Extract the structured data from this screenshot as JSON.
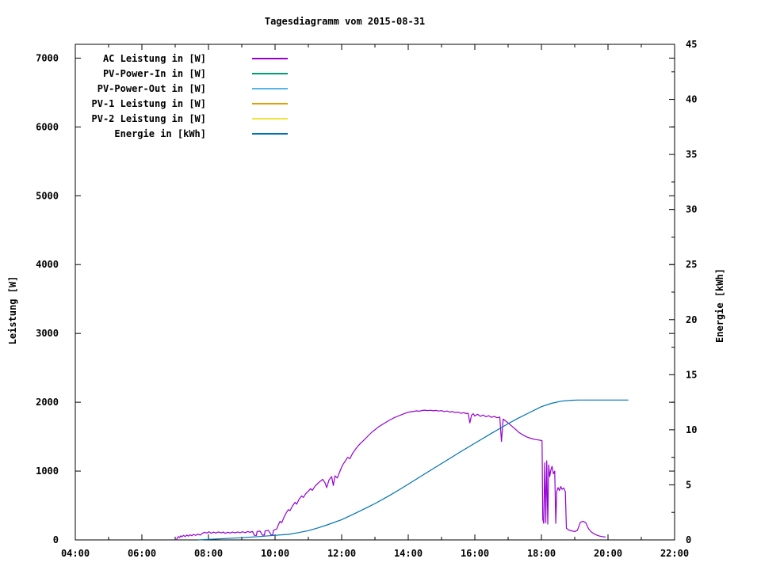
{
  "chart_data": {
    "type": "line",
    "title": "Tagesdiagramm vom 2015-08-31",
    "xlabel": "",
    "ylabel": "Leistung [W]",
    "y2label": "Energie [kWh]",
    "grid": false,
    "legend_position": "top-left-inside",
    "xlim_hours": [
      4,
      22
    ],
    "ylim": [
      0,
      7200
    ],
    "y2lim": [
      0,
      45
    ],
    "x_ticks": [
      {
        "hour": 4,
        "label": "04:00"
      },
      {
        "hour": 6,
        "label": "06:00"
      },
      {
        "hour": 8,
        "label": "08:00"
      },
      {
        "hour": 10,
        "label": "10:00"
      },
      {
        "hour": 12,
        "label": "12:00"
      },
      {
        "hour": 14,
        "label": "14:00"
      },
      {
        "hour": 16,
        "label": "16:00"
      },
      {
        "hour": 18,
        "label": "18:00"
      },
      {
        "hour": 20,
        "label": "20:00"
      },
      {
        "hour": 22,
        "label": "22:00"
      }
    ],
    "x_minor_hours": [
      5,
      7,
      9,
      11,
      13,
      15,
      17,
      19,
      21
    ],
    "y_ticks": [
      {
        "value": 0,
        "label": "0"
      },
      {
        "value": 1000,
        "label": "1000"
      },
      {
        "value": 2000,
        "label": "2000"
      },
      {
        "value": 3000,
        "label": "3000"
      },
      {
        "value": 4000,
        "label": "4000"
      },
      {
        "value": 5000,
        "label": "5000"
      },
      {
        "value": 6000,
        "label": "6000"
      },
      {
        "value": 7000,
        "label": "7000"
      }
    ],
    "y2_ticks": [
      {
        "value": 0,
        "label": "0"
      },
      {
        "value": 5,
        "label": "5"
      },
      {
        "value": 10,
        "label": "10"
      },
      {
        "value": 15,
        "label": "15"
      },
      {
        "value": 20,
        "label": "20"
      },
      {
        "value": 25,
        "label": "25"
      },
      {
        "value": 30,
        "label": "30"
      },
      {
        "value": 35,
        "label": "35"
      },
      {
        "value": 40,
        "label": "40"
      },
      {
        "value": 45,
        "label": "45"
      }
    ],
    "y2_minor": [
      2.5,
      7.5,
      12.5,
      17.5,
      22.5,
      27.5,
      32.5,
      37.5,
      42.5
    ],
    "colors": {
      "axis": "#000000",
      "background": "#ffffff",
      "ac": "#9400d3",
      "pv_power_in": "#009e73",
      "pv_power_out": "#56b4e9",
      "pv1": "#e69f00",
      "pv2": "#f0e442",
      "energie": "#0072b2"
    },
    "legend": [
      {
        "label": "AC Leistung in [W]",
        "color": "#9400d3"
      },
      {
        "label": "PV-Power-In in [W]",
        "color": "#009e73"
      },
      {
        "label": "PV-Power-Out in [W]",
        "color": "#56b4e9"
      },
      {
        "label": "PV-1 Leistung in [W]",
        "color": "#e69f00"
      },
      {
        "label": "PV-2 Leistung in [W]",
        "color": "#f0e442"
      },
      {
        "label": "Energie in [kWh]",
        "color": "#0072b2"
      }
    ],
    "series": [
      {
        "name": "AC Leistung in [W]",
        "color": "#9400d3",
        "axis": "left",
        "points": [
          [
            7.03,
            0
          ],
          [
            7.07,
            30
          ],
          [
            7.1,
            50
          ],
          [
            7.13,
            35
          ],
          [
            7.17,
            60
          ],
          [
            7.2,
            45
          ],
          [
            7.25,
            65
          ],
          [
            7.3,
            50
          ],
          [
            7.35,
            70
          ],
          [
            7.4,
            55
          ],
          [
            7.45,
            75
          ],
          [
            7.5,
            60
          ],
          [
            7.55,
            80
          ],
          [
            7.62,
            65
          ],
          [
            7.68,
            85
          ],
          [
            7.75,
            70
          ],
          [
            7.82,
            95
          ],
          [
            7.88,
            112
          ],
          [
            7.95,
            100
          ],
          [
            8.02,
            118
          ],
          [
            8.08,
            96
          ],
          [
            8.15,
            114
          ],
          [
            8.22,
            100
          ],
          [
            8.3,
            116
          ],
          [
            8.38,
            102
          ],
          [
            8.45,
            114
          ],
          [
            8.5,
            96
          ],
          [
            8.58,
            112
          ],
          [
            8.65,
            100
          ],
          [
            8.72,
            114
          ],
          [
            8.8,
            102
          ],
          [
            8.88,
            116
          ],
          [
            8.95,
            104
          ],
          [
            9.02,
            118
          ],
          [
            9.1,
            106
          ],
          [
            9.18,
            122
          ],
          [
            9.25,
            110
          ],
          [
            9.32,
            124
          ],
          [
            9.38,
            66
          ],
          [
            9.44,
            66
          ],
          [
            9.46,
            122
          ],
          [
            9.55,
            128
          ],
          [
            9.62,
            70
          ],
          [
            9.68,
            70
          ],
          [
            9.7,
            130
          ],
          [
            9.8,
            138
          ],
          [
            9.88,
            74
          ],
          [
            9.93,
            74
          ],
          [
            9.95,
            140
          ],
          [
            10.0,
            150
          ],
          [
            10.05,
            160
          ],
          [
            10.1,
            220
          ],
          [
            10.15,
            270
          ],
          [
            10.2,
            250
          ],
          [
            10.27,
            330
          ],
          [
            10.33,
            390
          ],
          [
            10.4,
            440
          ],
          [
            10.45,
            425
          ],
          [
            10.52,
            490
          ],
          [
            10.6,
            545
          ],
          [
            10.65,
            520
          ],
          [
            10.72,
            590
          ],
          [
            10.8,
            640
          ],
          [
            10.85,
            615
          ],
          [
            10.92,
            670
          ],
          [
            11.0,
            710
          ],
          [
            11.07,
            745
          ],
          [
            11.12,
            720
          ],
          [
            11.2,
            780
          ],
          [
            11.28,
            820
          ],
          [
            11.35,
            850
          ],
          [
            11.43,
            880
          ],
          [
            11.5,
            830
          ],
          [
            11.55,
            760
          ],
          [
            11.62,
            870
          ],
          [
            11.7,
            920
          ],
          [
            11.75,
            790
          ],
          [
            11.8,
            930
          ],
          [
            11.87,
            900
          ],
          [
            11.95,
            1000
          ],
          [
            12.02,
            1080
          ],
          [
            12.1,
            1140
          ],
          [
            12.18,
            1200
          ],
          [
            12.25,
            1180
          ],
          [
            12.33,
            1260
          ],
          [
            12.42,
            1320
          ],
          [
            12.5,
            1370
          ],
          [
            12.58,
            1410
          ],
          [
            12.67,
            1450
          ],
          [
            12.75,
            1490
          ],
          [
            12.83,
            1530
          ],
          [
            12.92,
            1570
          ],
          [
            13.0,
            1600
          ],
          [
            13.1,
            1640
          ],
          [
            13.2,
            1670
          ],
          [
            13.3,
            1700
          ],
          [
            13.4,
            1730
          ],
          [
            13.5,
            1755
          ],
          [
            13.6,
            1780
          ],
          [
            13.7,
            1800
          ],
          [
            13.8,
            1820
          ],
          [
            13.9,
            1838
          ],
          [
            14.0,
            1855
          ],
          [
            14.08,
            1862
          ],
          [
            14.17,
            1868
          ],
          [
            14.25,
            1875
          ],
          [
            14.33,
            1870
          ],
          [
            14.42,
            1880
          ],
          [
            14.5,
            1885
          ],
          [
            14.58,
            1878
          ],
          [
            14.67,
            1884
          ],
          [
            14.75,
            1876
          ],
          [
            14.83,
            1882
          ],
          [
            14.92,
            1872
          ],
          [
            15.0,
            1878
          ],
          [
            15.08,
            1866
          ],
          [
            15.17,
            1872
          ],
          [
            15.25,
            1858
          ],
          [
            15.33,
            1864
          ],
          [
            15.42,
            1850
          ],
          [
            15.5,
            1858
          ],
          [
            15.58,
            1840
          ],
          [
            15.67,
            1848
          ],
          [
            15.75,
            1835
          ],
          [
            15.8,
            1840
          ],
          [
            15.85,
            1700
          ],
          [
            15.9,
            1810
          ],
          [
            15.95,
            1835
          ],
          [
            16.0,
            1800
          ],
          [
            16.08,
            1825
          ],
          [
            16.17,
            1795
          ],
          [
            16.25,
            1815
          ],
          [
            16.33,
            1790
          ],
          [
            16.42,
            1805
          ],
          [
            16.5,
            1780
          ],
          [
            16.58,
            1795
          ],
          [
            16.67,
            1775
          ],
          [
            16.75,
            1785
          ],
          [
            16.8,
            1430
          ],
          [
            16.85,
            1755
          ],
          [
            16.92,
            1730
          ],
          [
            17.0,
            1700
          ],
          [
            17.08,
            1665
          ],
          [
            17.17,
            1630
          ],
          [
            17.25,
            1595
          ],
          [
            17.33,
            1560
          ],
          [
            17.42,
            1532
          ],
          [
            17.5,
            1510
          ],
          [
            17.58,
            1492
          ],
          [
            17.67,
            1478
          ],
          [
            17.75,
            1466
          ],
          [
            17.83,
            1458
          ],
          [
            17.92,
            1452
          ],
          [
            18.0,
            1445
          ],
          [
            18.02,
            1440
          ],
          [
            18.04,
            300
          ],
          [
            18.07,
            240
          ],
          [
            18.1,
            1120
          ],
          [
            18.13,
            250
          ],
          [
            18.16,
            1150
          ],
          [
            18.19,
            230
          ],
          [
            18.22,
            1090
          ],
          [
            18.25,
            920
          ],
          [
            18.28,
            1010
          ],
          [
            18.32,
            1070
          ],
          [
            18.36,
            960
          ],
          [
            18.4,
            1000
          ],
          [
            18.43,
            240
          ],
          [
            18.46,
            700
          ],
          [
            18.5,
            760
          ],
          [
            18.54,
            718
          ],
          [
            18.58,
            775
          ],
          [
            18.62,
            735
          ],
          [
            18.67,
            755
          ],
          [
            18.72,
            700
          ],
          [
            18.75,
            170
          ],
          [
            18.82,
            145
          ],
          [
            18.9,
            132
          ],
          [
            19.0,
            122
          ],
          [
            19.08,
            140
          ],
          [
            19.17,
            255
          ],
          [
            19.25,
            272
          ],
          [
            19.33,
            250
          ],
          [
            19.42,
            160
          ],
          [
            19.5,
            115
          ],
          [
            19.58,
            88
          ],
          [
            19.67,
            68
          ],
          [
            19.75,
            55
          ],
          [
            19.83,
            48
          ],
          [
            19.92,
            42
          ]
        ]
      },
      {
        "name": "Energie in [kWh]",
        "color": "#0072b2",
        "axis": "right",
        "points": [
          [
            7.7,
            0
          ],
          [
            8.0,
            0.05
          ],
          [
            8.5,
            0.12
          ],
          [
            9.0,
            0.2
          ],
          [
            9.5,
            0.3
          ],
          [
            10.0,
            0.42
          ],
          [
            10.4,
            0.5
          ],
          [
            10.7,
            0.66
          ],
          [
            11.0,
            0.84
          ],
          [
            11.3,
            1.1
          ],
          [
            11.6,
            1.4
          ],
          [
            12.0,
            1.84
          ],
          [
            12.4,
            2.4
          ],
          [
            12.8,
            3.0
          ],
          [
            13.0,
            3.3
          ],
          [
            13.4,
            3.97
          ],
          [
            13.7,
            4.5
          ],
          [
            14.0,
            5.06
          ],
          [
            14.3,
            5.62
          ],
          [
            14.6,
            6.19
          ],
          [
            15.0,
            6.94
          ],
          [
            15.3,
            7.5
          ],
          [
            15.6,
            8.06
          ],
          [
            15.9,
            8.6
          ],
          [
            16.2,
            9.14
          ],
          [
            16.5,
            9.68
          ],
          [
            16.8,
            10.2
          ],
          [
            17.0,
            10.56
          ],
          [
            17.3,
            11.05
          ],
          [
            17.6,
            11.5
          ],
          [
            18.0,
            12.1
          ],
          [
            18.3,
            12.4
          ],
          [
            18.6,
            12.6
          ],
          [
            18.9,
            12.68
          ],
          [
            19.1,
            12.7
          ],
          [
            19.5,
            12.7
          ],
          [
            20.0,
            12.7
          ],
          [
            20.6,
            12.7
          ]
        ]
      }
    ]
  }
}
